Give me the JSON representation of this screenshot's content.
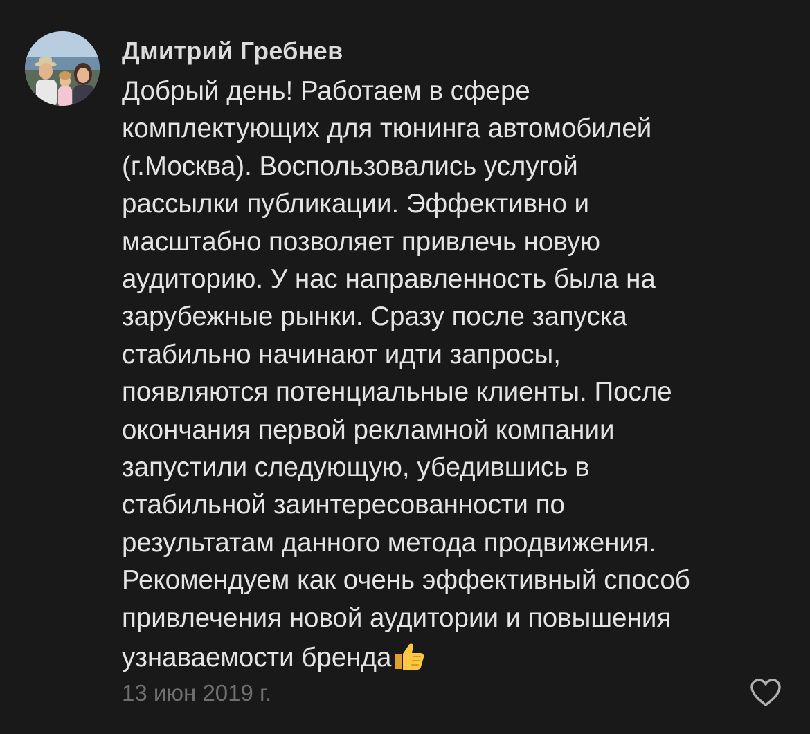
{
  "comment": {
    "author": "Дмитрий Гребнев",
    "text_lines": [
      "Добрый день! Работаем в сфере",
      "комплектующих для тюнинга автомобилей",
      "(г.Москва). Воспользовались услугой",
      "рассылки публикации. Эффективно и",
      "масштабно позволяет привлечь новую",
      "аудиторию. У нас направленность была на",
      "зарубежные рынки. Сразу после запуска",
      "стабильно начинают идти запросы,",
      "появляются потенциальные клиенты. После",
      "окончания первой рекламной компании",
      "запустили следующую, убедившись в",
      "стабильной заинтересованности по",
      "результатам данного метода продвижения.",
      "Рекомендуем как очень эффективный способ",
      "привлечения новой аудитории и повышения",
      "узнаваемости бренда"
    ],
    "emoji": "thumbs-up",
    "date": "13 июн 2019 г.",
    "like_icon": "heart-outline-icon",
    "avatar_icon": "user-photo-avatar"
  },
  "colors": {
    "background": "#19191a",
    "author": "#dcdcdc",
    "text": "#e4e4e4",
    "date": "#6f6f72",
    "icon": "#b0b0b3"
  }
}
